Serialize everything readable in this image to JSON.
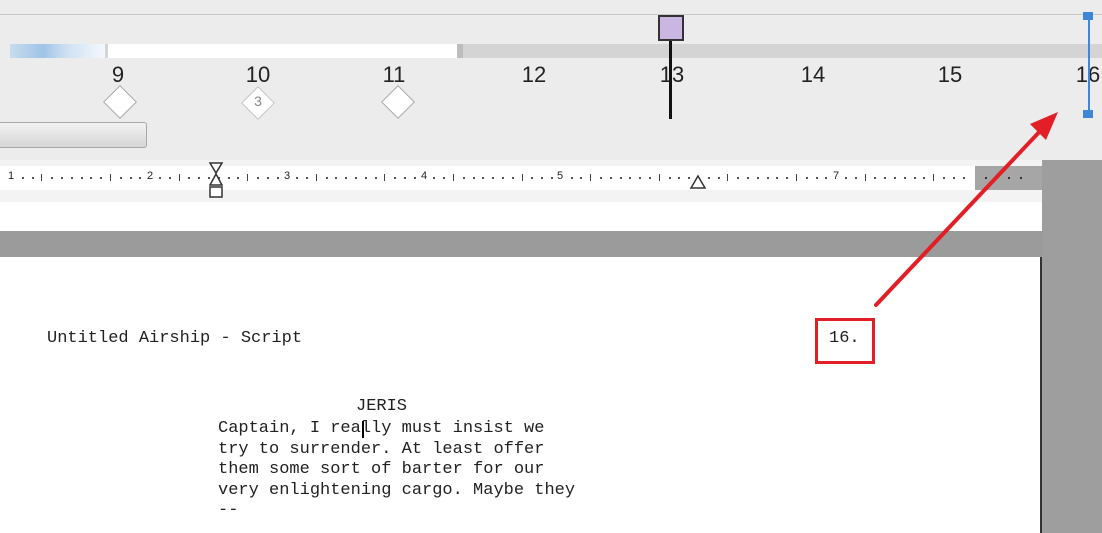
{
  "timeline": {
    "ticks": [
      "9",
      "10",
      "11",
      "12",
      "13",
      "14",
      "15",
      "16"
    ],
    "marker_label": "3"
  },
  "ruler": {
    "numbers": [
      "1",
      "2",
      "3",
      "4",
      "5",
      "7"
    ]
  },
  "script": {
    "header_title": "Untitled Airship - Script",
    "page_number": "16.",
    "character": "JERIS",
    "dialogue": [
      "Captain, I really must insist we",
      "try to surrender. At least offer",
      "them some sort of barter for our",
      "very enlightening cargo. Maybe they",
      "--"
    ]
  },
  "colors": {
    "annotation": "#e21f26",
    "playhead": "#c9b6e2",
    "end_marker": "#3f86d6"
  }
}
